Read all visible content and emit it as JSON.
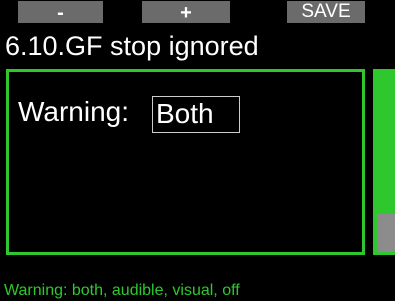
{
  "softkeys": {
    "minus_label": "-",
    "plus_label": "+",
    "save_label": "SAVE"
  },
  "header": {
    "title": "6.10.GF stop ignored"
  },
  "setting": {
    "label": "Warning:",
    "value": "Both"
  },
  "scrollbar": {
    "position": "bottom"
  },
  "footer": {
    "help": "Warning: both, audible, visual, off"
  },
  "colors": {
    "accent": "#2ec82e",
    "softkey_bg": "#6b6b6b",
    "background": "#000000",
    "text": "#ffffff",
    "scroll_thumb": "#8c8c8c"
  }
}
